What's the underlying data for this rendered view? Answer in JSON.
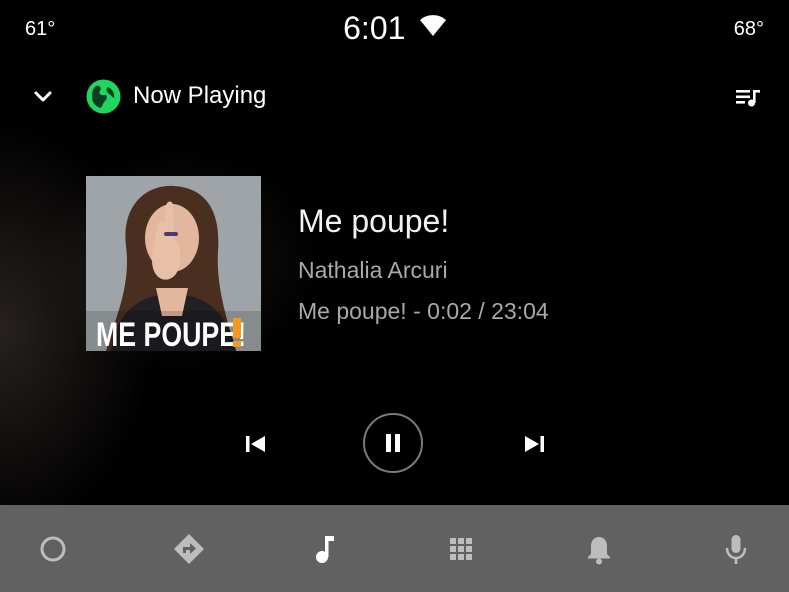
{
  "status_bar": {
    "temp_left": "61°",
    "time": "6:01",
    "temp_right": "68°",
    "wifi_icon": "wifi-icon"
  },
  "header": {
    "title": "Now Playing",
    "collapse_icon": "chevron-down-icon",
    "app_icon": "podcast-app-icon",
    "queue_icon": "queue-music-icon"
  },
  "track": {
    "title": "Me poupe!",
    "artist": "Nathalia Arcuri",
    "album": "Me poupe!",
    "separator": " - ",
    "elapsed": "0:02",
    "duration": "23:04",
    "album_art_text": "ME POUPE!"
  },
  "controls": {
    "previous_icon": "skip-previous-icon",
    "play_state_icon": "pause-icon",
    "next_icon": "skip-next-icon"
  },
  "nav": {
    "items": [
      {
        "icon": "home-circle-icon"
      },
      {
        "icon": "navigation-icon"
      },
      {
        "icon": "music-note-icon",
        "active": true
      },
      {
        "icon": "apps-grid-icon"
      },
      {
        "icon": "notification-bell-icon"
      },
      {
        "icon": "microphone-icon"
      }
    ]
  },
  "colors": {
    "background": "#000000",
    "nav_bar": "#616161",
    "nav_icon": "#bdbdbd",
    "nav_icon_active": "#ffffff",
    "secondary_text": "#a9a9a9",
    "app_icon": "#1ed760"
  }
}
